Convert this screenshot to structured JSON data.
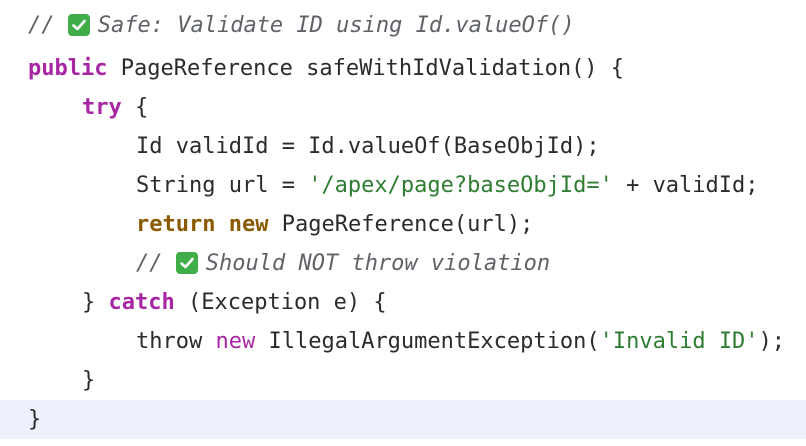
{
  "code": {
    "line1": {
      "prefix": "// ",
      "icon": "check-mark-icon",
      "text": "Safe: Validate ID using Id.valueOf()"
    },
    "line2": {
      "kw": "public",
      "rest": " PageReference safeWithIdValidation() {"
    },
    "line3": {
      "kw": "try",
      "rest": " {"
    },
    "line4": {
      "text": "Id validId = Id.valueOf(BaseObjId);"
    },
    "line5": {
      "pre": "String url = ",
      "str": "'/apex/page?baseObjId='",
      "post": " + validId;"
    },
    "line6": {
      "kw1": "return",
      "kw2": "new",
      "rest": " PageReference(url);"
    },
    "line7": {
      "prefix": "// ",
      "icon": "check-mark-icon",
      "text": "Should NOT throw violation"
    },
    "line8": {
      "pre": "} ",
      "kw": "catch",
      "rest": " (Exception e) {"
    },
    "line9": {
      "pre": "throw ",
      "kw": "new",
      "mid": " IllegalArgumentException(",
      "str": "'Invalid ID'",
      "post": ");"
    },
    "line10": {
      "text": "}"
    },
    "line11": {
      "text": "}"
    }
  },
  "colors": {
    "keyword_purple": "#a626a4",
    "keyword_brown": "#8a5a00",
    "string_green": "#2e7d32",
    "comment_gray": "#5f6368",
    "current_line_bg": "#eef1fb",
    "check_green": "#3fae49"
  }
}
